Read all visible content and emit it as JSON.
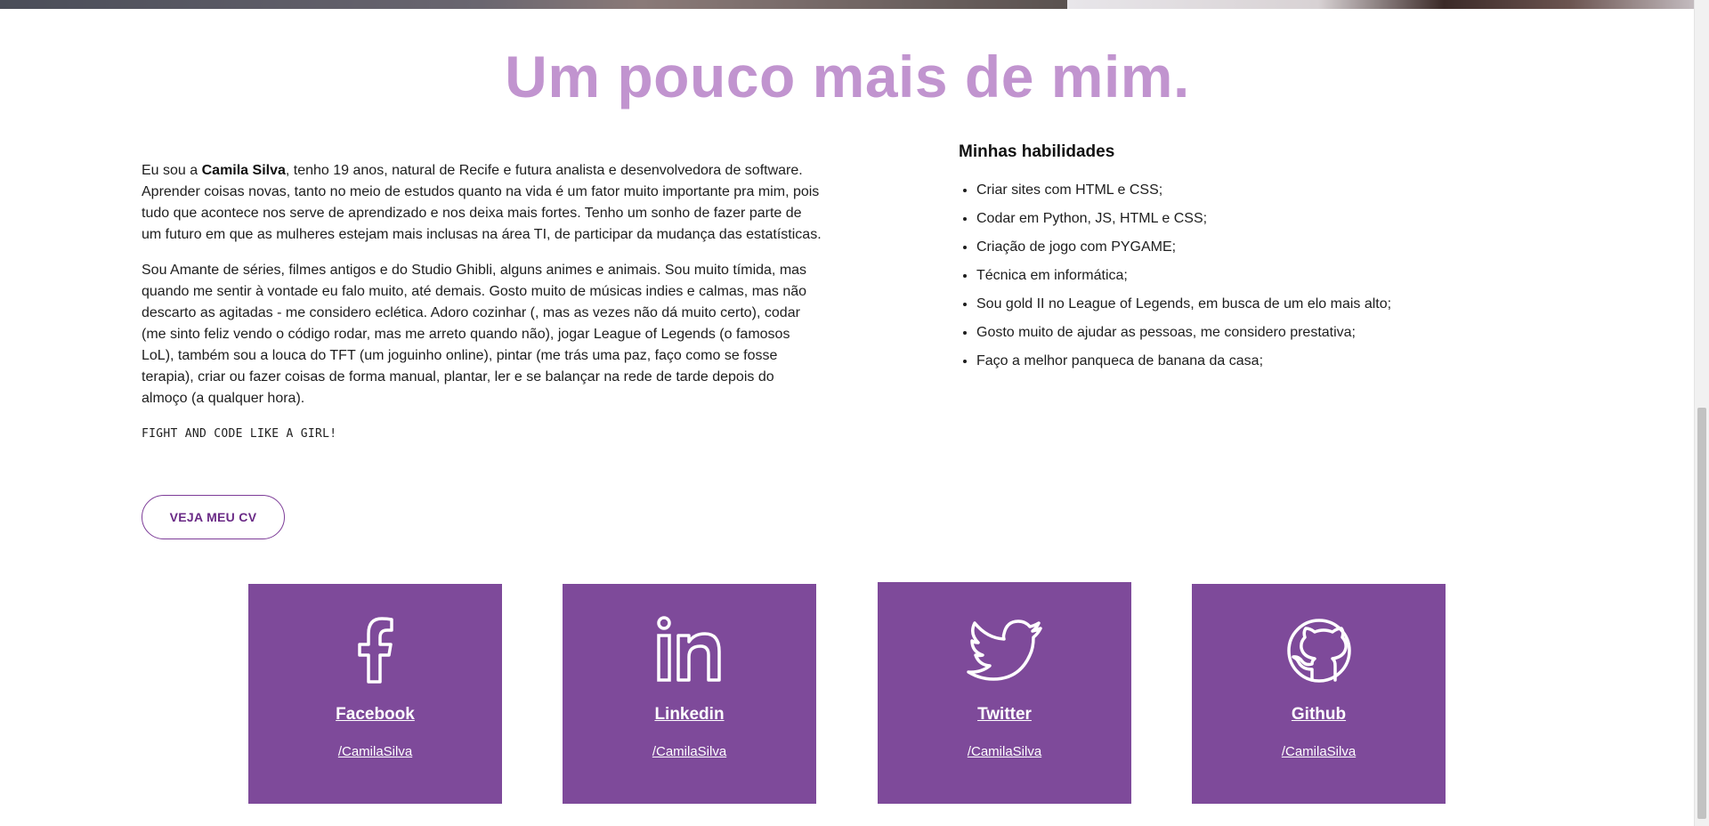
{
  "section_title": "Um pouco mais de mim.",
  "about": {
    "p1_intro": "Eu sou a ",
    "p1_name": "Camila Silva",
    "p1_rest": ", tenho 19 anos, natural de Recife e futura analista e desenvolvedora de software. Aprender coisas novas, tanto no meio de estudos quanto na vida é um fator muito importante pra mim, pois tudo que acontece nos serve de aprendizado e nos deixa mais fortes. Tenho um sonho de fazer parte de um futuro em que as mulheres estejam mais inclusas na área TI, de participar da mudança das estatísticas.",
    "p2": "Sou Amante de séries, filmes antigos e do Studio Ghibli, alguns animes e animais. Sou muito tímida, mas quando me sentir à vontade eu falo muito, até demais. Gosto muito de músicas indies e calmas, mas não descarto as agitadas - me considero eclética. Adoro cozinhar (, mas as vezes não dá muito certo), codar (me sinto feliz vendo o código rodar, mas me arreto quando não), jogar League of Legends (o famosos LoL), também sou a louca do TFT (um joguinho online), pintar (me trás uma paz, faço como se fosse terapia), criar ou fazer coisas de forma manual, plantar, ler e se balançar na rede de tarde depois do almoço (a qualquer hora).",
    "quote": "FIGHT AND CODE LIKE A GIRL!",
    "cv_button": "VEJA MEU CV"
  },
  "skills": {
    "title": "Minhas habilidades",
    "items": [
      "Criar sites com HTML e CSS;",
      "Codar em Python, JS, HTML e CSS;",
      "Criação de jogo com PYGAME;",
      "Técnica em informática;",
      "Sou gold II no League of Legends, em busca de um elo mais alto;",
      "Gosto muito de ajudar as pessoas, me considero prestativa;",
      "Faço a melhor panqueca de banana da casa;"
    ]
  },
  "social": [
    {
      "name": "Facebook",
      "handle": "/CamilaSilva",
      "icon": "facebook-icon"
    },
    {
      "name": "Linkedin",
      "handle": "/CamilaSilva",
      "icon": "linkedin-icon"
    },
    {
      "name": "Twitter",
      "handle": "/CamilaSilva",
      "icon": "twitter-icon"
    },
    {
      "name": "Github",
      "handle": "/CamilaSilva",
      "icon": "github-icon"
    }
  ],
  "colors": {
    "title": "#c194cf",
    "card_bg": "#7e4a9a",
    "button_border": "#7d3c98"
  }
}
